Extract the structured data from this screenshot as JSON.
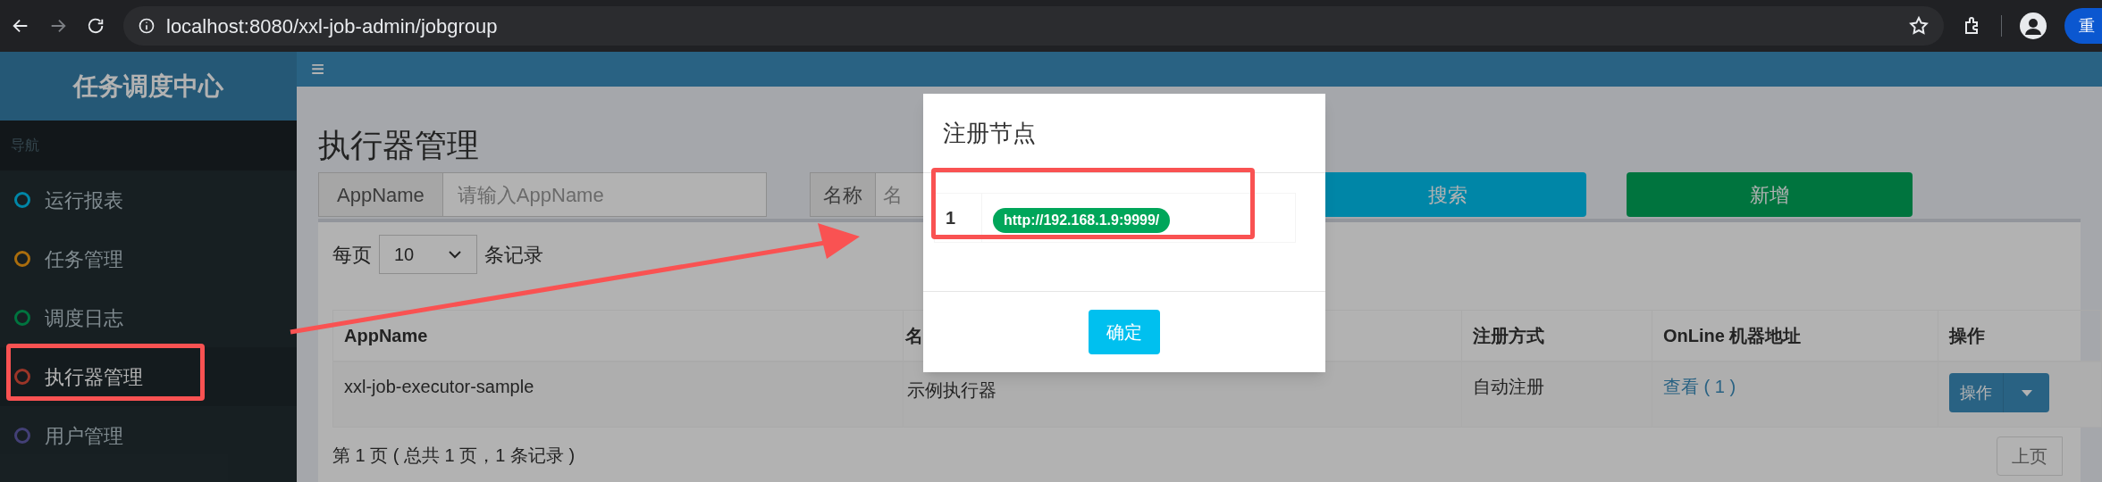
{
  "browser": {
    "url": "localhost:8080/xxl-job-admin/jobgroup",
    "profile_button": "重"
  },
  "header": {
    "logo": "任务调度中心",
    "menu_toggle": "≡"
  },
  "sidebar": {
    "heading": "导航",
    "items": [
      {
        "label": "运行报表",
        "color": "#0086a7",
        "selected": false
      },
      {
        "label": "任务管理",
        "color": "#aa6d0d",
        "selected": false
      },
      {
        "label": "调度日志",
        "color": "#00743f",
        "selected": false
      },
      {
        "label": "执行器管理",
        "color": "#9b3528",
        "selected": true
      },
      {
        "label": "用户管理",
        "color": "#434076",
        "selected": false
      }
    ]
  },
  "page": {
    "title": "执行器管理",
    "filters": [
      {
        "label": "AppName",
        "placeholder": "请输入AppName"
      },
      {
        "label": "名称",
        "placeholder": "名"
      }
    ],
    "search_button": "搜索",
    "add_button": "新增",
    "page_size": {
      "before": "每页",
      "value": "10",
      "after": "条记录"
    },
    "table": {
      "columns": [
        "AppName",
        "名",
        "注册方式",
        "OnLine 机器地址",
        "操作"
      ],
      "rows": [
        {
          "appname": "xxl-job-executor-sample",
          "name": "示例执行器",
          "registration": "自动注册",
          "online_link": "查看 ( 1 )",
          "action": "操作"
        }
      ]
    },
    "footer": "第 1 页 ( 总共 1 页，1 条记录 )",
    "prev_button": "上页"
  },
  "modal": {
    "title": "注册节点",
    "rows": [
      {
        "index": "1",
        "address": "http://192.168.1.9:9999/"
      }
    ],
    "ok_button": "确定"
  }
}
